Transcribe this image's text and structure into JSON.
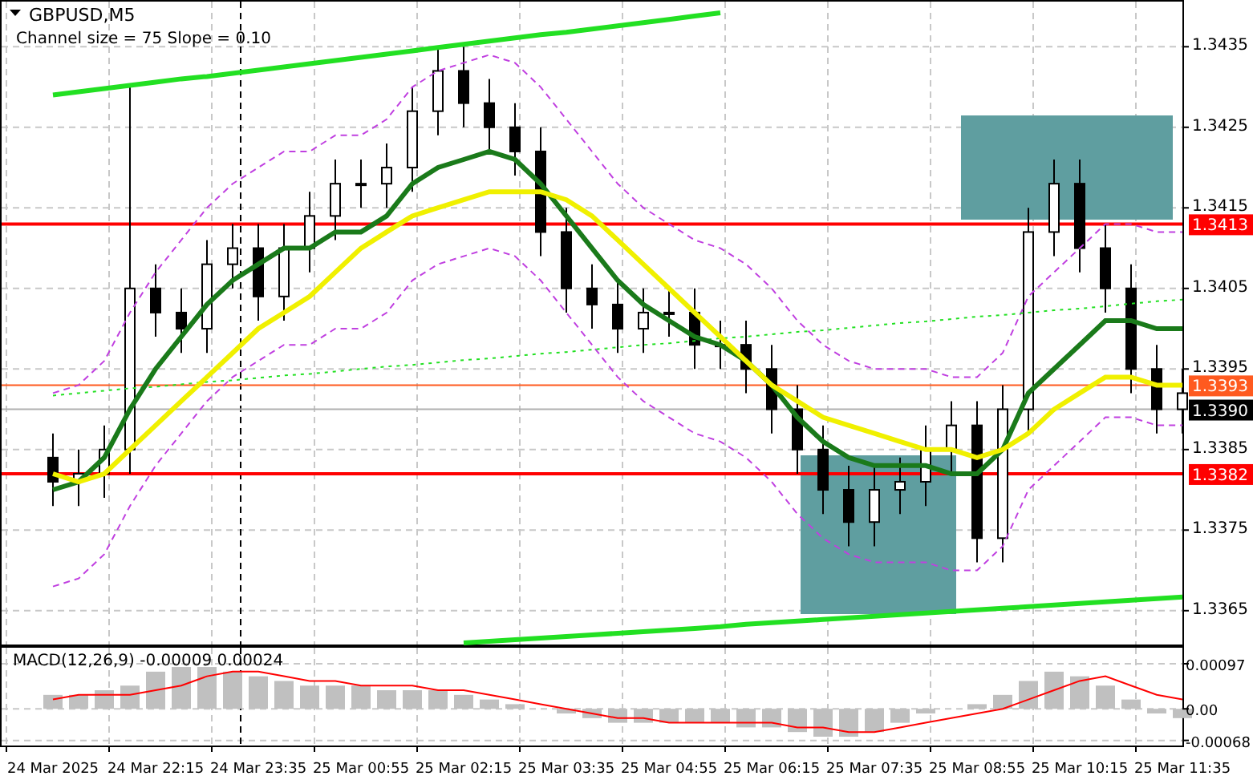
{
  "header": {
    "symbol": "GBPUSD,M5",
    "indicator": "Channel size = 75 Slope = 0.10"
  },
  "price_chart": {
    "chart_data": {
      "type": "candlestick",
      "ylim": [
        1.33608,
        1.34408
      ],
      "grid": true,
      "yticks": [
        {
          "value": 1.3435,
          "label": "1.3435"
        },
        {
          "value": 1.3425,
          "label": "1.3425"
        },
        {
          "value": 1.3415,
          "label": "1.3415"
        },
        {
          "value": 1.3405,
          "label": "1.3405"
        },
        {
          "value": 1.3395,
          "label": "1.3395"
        },
        {
          "value": 1.3385,
          "label": "1.3385"
        },
        {
          "value": 1.3375,
          "label": "1.3375"
        },
        {
          "value": 1.3365,
          "label": "1.3365"
        }
      ],
      "ohlc": [
        [
          1.3384,
          1.3387,
          1.3378,
          1.3381
        ],
        [
          1.3381,
          1.3385,
          1.3378,
          1.3382
        ],
        [
          1.3382,
          1.3388,
          1.3379,
          1.3385
        ],
        [
          1.3385,
          1.343,
          1.3382,
          1.3405
        ],
        [
          1.3405,
          1.3408,
          1.3399,
          1.3402
        ],
        [
          1.3402,
          1.3405,
          1.3397,
          1.34
        ],
        [
          1.34,
          1.3411,
          1.3397,
          1.3408
        ],
        [
          1.3408,
          1.3413,
          1.3405,
          1.341
        ],
        [
          1.341,
          1.3413,
          1.3401,
          1.3404
        ],
        [
          1.3404,
          1.3413,
          1.3401,
          1.341
        ],
        [
          1.341,
          1.3417,
          1.3407,
          1.3414
        ],
        [
          1.3414,
          1.3421,
          1.3411,
          1.3418
        ],
        [
          1.3418,
          1.3421,
          1.3415,
          1.3418
        ],
        [
          1.3418,
          1.3423,
          1.3415,
          1.342
        ],
        [
          1.342,
          1.343,
          1.3417,
          1.3427
        ],
        [
          1.3427,
          1.3435,
          1.3424,
          1.3432
        ],
        [
          1.3432,
          1.3435,
          1.3425,
          1.3428
        ],
        [
          1.3428,
          1.3431,
          1.3422,
          1.3425
        ],
        [
          1.3425,
          1.3428,
          1.3419,
          1.3422
        ],
        [
          1.3422,
          1.3425,
          1.3409,
          1.3412
        ],
        [
          1.3412,
          1.3415,
          1.3402,
          1.3405
        ],
        [
          1.3405,
          1.3408,
          1.34,
          1.3403
        ],
        [
          1.3403,
          1.3406,
          1.3397,
          1.34
        ],
        [
          1.34,
          1.3405,
          1.3397,
          1.3402
        ],
        [
          1.3402,
          1.3405,
          1.3399,
          1.3402
        ],
        [
          1.3402,
          1.3405,
          1.3395,
          1.3398
        ],
        [
          1.3398,
          1.3401,
          1.3395,
          1.3398
        ],
        [
          1.3398,
          1.3401,
          1.3392,
          1.3395
        ],
        [
          1.3395,
          1.3398,
          1.3387,
          1.339
        ],
        [
          1.339,
          1.3393,
          1.3382,
          1.3385
        ],
        [
          1.3385,
          1.3388,
          1.3377,
          1.338
        ],
        [
          1.338,
          1.3383,
          1.3373,
          1.3376
        ],
        [
          1.3376,
          1.3383,
          1.3373,
          1.338
        ],
        [
          1.338,
          1.3384,
          1.3377,
          1.3381
        ],
        [
          1.3381,
          1.3388,
          1.3378,
          1.3385
        ],
        [
          1.3385,
          1.3391,
          1.3382,
          1.3388
        ],
        [
          1.3388,
          1.3391,
          1.3371,
          1.3374
        ],
        [
          1.3374,
          1.3393,
          1.3371,
          1.339
        ],
        [
          1.339,
          1.3415,
          1.3387,
          1.3412
        ],
        [
          1.3412,
          1.3421,
          1.3409,
          1.3418
        ],
        [
          1.3418,
          1.3421,
          1.3407,
          1.341
        ],
        [
          1.341,
          1.3413,
          1.3402,
          1.3405
        ],
        [
          1.3405,
          1.3408,
          1.3392,
          1.3395
        ],
        [
          1.3395,
          1.3398,
          1.3387,
          1.339
        ],
        [
          1.339,
          1.3395,
          1.3387,
          1.3392
        ]
      ],
      "series": [
        {
          "type": "line",
          "color": "#c040e0",
          "line_style": "dashed",
          "values": [
            1.3392,
            1.3393,
            1.3396,
            1.3402,
            1.3407,
            1.3411,
            1.3415,
            1.3418,
            1.342,
            1.3422,
            1.3422,
            1.3424,
            1.3424,
            1.3426,
            1.343,
            1.3432,
            1.3433,
            1.3434,
            1.3433,
            1.343,
            1.3426,
            1.3422,
            1.3418,
            1.3415,
            1.3413,
            1.3411,
            1.341,
            1.3408,
            1.3405,
            1.3401,
            1.3398,
            1.3396,
            1.3395,
            1.3395,
            1.3395,
            1.3394,
            1.3394,
            1.3397,
            1.3404,
            1.3407,
            1.341,
            1.3413,
            1.3413,
            1.3412,
            1.3412
          ]
        },
        {
          "type": "line",
          "color": "#c040e0",
          "line_style": "dashed",
          "values": [
            1.3368,
            1.3369,
            1.3372,
            1.3378,
            1.3383,
            1.3387,
            1.3391,
            1.3394,
            1.3396,
            1.3398,
            1.3398,
            1.34,
            1.34,
            1.3402,
            1.3406,
            1.3408,
            1.3409,
            1.341,
            1.3409,
            1.3406,
            1.3402,
            1.3398,
            1.3394,
            1.3391,
            1.3389,
            1.3387,
            1.3386,
            1.3384,
            1.3381,
            1.3377,
            1.3374,
            1.3372,
            1.3371,
            1.3371,
            1.3371,
            1.337,
            1.337,
            1.3373,
            1.338,
            1.3383,
            1.3386,
            1.3389,
            1.3389,
            1.3388,
            1.3388
          ]
        },
        {
          "type": "line",
          "color": "#22e022",
          "line_style": "solid",
          "values": [
            1.3429,
            1.34294,
            1.34298,
            1.34302,
            1.34306,
            1.3431,
            1.34313,
            1.34317,
            1.34321,
            1.34325,
            1.34329,
            1.34333,
            1.34337,
            1.34341,
            1.34345,
            1.34349,
            1.34353,
            1.34357,
            1.34361,
            1.34365,
            1.34368,
            1.34372,
            1.34376,
            1.3438,
            1.34384,
            1.34388,
            1.34392,
            null,
            null,
            null,
            null,
            null,
            null,
            null,
            null,
            null,
            null,
            null,
            null,
            null,
            null,
            null,
            null,
            null,
            null
          ]
        },
        {
          "type": "line",
          "color": "#22e022",
          "line_style": "solid",
          "values": [
            null,
            null,
            null,
            null,
            null,
            null,
            null,
            null,
            null,
            null,
            null,
            null,
            null,
            null,
            null,
            null,
            1.3361,
            1.33612,
            1.33614,
            1.33616,
            1.33618,
            1.3362,
            1.33622,
            1.33624,
            1.33626,
            1.33628,
            1.3363,
            1.33633,
            1.33635,
            1.33637,
            1.33639,
            1.33641,
            1.33643,
            1.33645,
            1.33647,
            1.33649,
            1.33651,
            1.33653,
            1.33655,
            1.33657,
            1.33659,
            1.33661,
            1.33663,
            1.33665,
            1.33667
          ]
        },
        {
          "type": "line",
          "color": "#22e022",
          "line_style": "dotted",
          "values": [
            1.33917,
            1.3392,
            1.33923,
            1.33926,
            1.33928,
            1.33931,
            1.33934,
            1.33936,
            1.33939,
            1.33942,
            1.33944,
            1.33947,
            1.3395,
            1.33953,
            1.33955,
            1.33958,
            1.33961,
            1.33963,
            1.33966,
            1.33969,
            1.33971,
            1.33974,
            1.33977,
            1.3398,
            1.33982,
            1.33985,
            1.33988,
            1.3399,
            1.33993,
            1.33996,
            1.33998,
            1.34001,
            1.34004,
            1.34007,
            1.34009,
            1.34012,
            1.34015,
            1.34017,
            1.3402,
            1.34023,
            1.34025,
            1.34028,
            1.34031,
            1.34034,
            1.34036
          ]
        },
        {
          "type": "line",
          "color": "#1a7a1a",
          "line_style": "solid",
          "values": [
            1.338,
            1.3381,
            1.3384,
            1.339,
            1.3395,
            1.3399,
            1.3403,
            1.3406,
            1.3408,
            1.341,
            1.341,
            1.3412,
            1.3412,
            1.3414,
            1.3418,
            1.342,
            1.3421,
            1.3422,
            1.3421,
            1.3418,
            1.3414,
            1.341,
            1.3406,
            1.3403,
            1.3401,
            1.3399,
            1.3398,
            1.3396,
            1.3393,
            1.3389,
            1.3386,
            1.3384,
            1.3383,
            1.3383,
            1.3383,
            1.3382,
            1.3382,
            1.3385,
            1.3392,
            1.3395,
            1.3398,
            1.3401,
            1.3401,
            1.34,
            1.34
          ]
        },
        {
          "type": "line",
          "color": "#f0f000",
          "line_style": "solid",
          "values": [
            1.3382,
            1.3381,
            1.3382,
            1.3385,
            1.3388,
            1.3391,
            1.3394,
            1.3397,
            1.34,
            1.3402,
            1.3404,
            1.3407,
            1.341,
            1.3412,
            1.3414,
            1.3415,
            1.3416,
            1.3417,
            1.3417,
            1.3417,
            1.3416,
            1.3414,
            1.3411,
            1.3408,
            1.3405,
            1.3402,
            1.3399,
            1.3396,
            1.3393,
            1.3391,
            1.3389,
            1.3388,
            1.3387,
            1.3386,
            1.3385,
            1.3385,
            1.3384,
            1.3385,
            1.3387,
            1.339,
            1.3392,
            1.3394,
            1.3394,
            1.3393,
            1.3393
          ]
        }
      ],
      "ref_lines": [
        {
          "axis": "y",
          "value": 1.3413,
          "color": "#ff0000",
          "line_style": "solid"
        },
        {
          "axis": "y",
          "value": 1.3393,
          "color": "#ff5a1f",
          "line_style": "solid"
        },
        {
          "axis": "y",
          "value": 1.339,
          "color": "#b0b0b0",
          "line_style": "solid"
        },
        {
          "axis": "y",
          "value": 1.3382,
          "color": "#ff0000",
          "line_style": "solid"
        }
      ]
    },
    "price_tags": [
      {
        "label": "1.3413",
        "color": "#ff0000"
      },
      {
        "label": "1.3393",
        "color": "#ff5a1f"
      },
      {
        "label": "1.3390",
        "color": "#000000"
      },
      {
        "label": "1.3382",
        "color": "#ff0000"
      }
    ]
  },
  "macd": {
    "title": "MACD(12,26,9) -0.00009 0.00024",
    "chart_data": {
      "type": "bar",
      "ylim": [
        -0.00079,
        0.00135
      ],
      "grid": true,
      "categories": [
        "24 Mar 2025",
        null,
        null,
        null,
        "24 Mar 22:15",
        null,
        null,
        null,
        "24 Mar 23:35",
        null,
        null,
        null,
        "25 Mar 00:55",
        null,
        null,
        null,
        "25 Mar 02:15",
        null,
        null,
        null,
        "25 Mar 03:35",
        null,
        null,
        null,
        "25 Mar 04:55",
        null,
        null,
        null,
        "25 Mar 06:15",
        null,
        null,
        null,
        "25 Mar 07:35",
        null,
        null,
        null,
        "25 Mar 08:55",
        null,
        null,
        null,
        "25 Mar 10:15",
        null,
        null,
        null,
        "25 Mar 11:35"
      ],
      "yticks": [
        {
          "value": 0.00097,
          "label": "0.00097"
        },
        {
          "value": 0,
          "label": "0.00"
        },
        {
          "value": -0.00068,
          "label": "-0.00068"
        }
      ],
      "series": [
        {
          "color": "#c0c0c0",
          "values": [
            0.0003,
            0.0003,
            0.0004,
            0.0005,
            0.0008,
            0.0009,
            0.0009,
            0.0008,
            0.0007,
            0.0006,
            0.0005,
            0.0005,
            0.0005,
            0.0004,
            0.0004,
            0.0004,
            0.0003,
            0.0002,
            0.0001,
            0,
            -0.0001,
            -0.0002,
            -0.0003,
            -0.0003,
            -0.0003,
            -0.0003,
            -0.0003,
            -0.0004,
            -0.0004,
            -0.0005,
            -0.0006,
            -0.0006,
            -0.0005,
            -0.0003,
            -0.0001,
            0,
            0.0001,
            0.0003,
            0.0006,
            0.0008,
            0.0007,
            0.0005,
            0.0002,
            -0.0001,
            -0.0002
          ]
        },
        {
          "color": "#ff0000",
          "type": "line",
          "values": [
            0.0002,
            0.0003,
            0.0003,
            0.0003,
            0.0004,
            0.0005,
            0.0007,
            0.0008,
            0.0008,
            0.0007,
            0.0006,
            0.0006,
            0.0005,
            0.0005,
            0.0005,
            0.0004,
            0.0004,
            0.0003,
            0.0002,
            0.0001,
            0,
            -0.0001,
            -0.0002,
            -0.0002,
            -0.0003,
            -0.0003,
            -0.0003,
            -0.0003,
            -0.0003,
            -0.0004,
            -0.0004,
            -0.0005,
            -0.0005,
            -0.0004,
            -0.0003,
            -0.0002,
            -0.0001,
            0,
            0.0002,
            0.0004,
            0.0006,
            0.0007,
            0.0005,
            0.0003,
            0.0002
          ]
        }
      ]
    }
  }
}
